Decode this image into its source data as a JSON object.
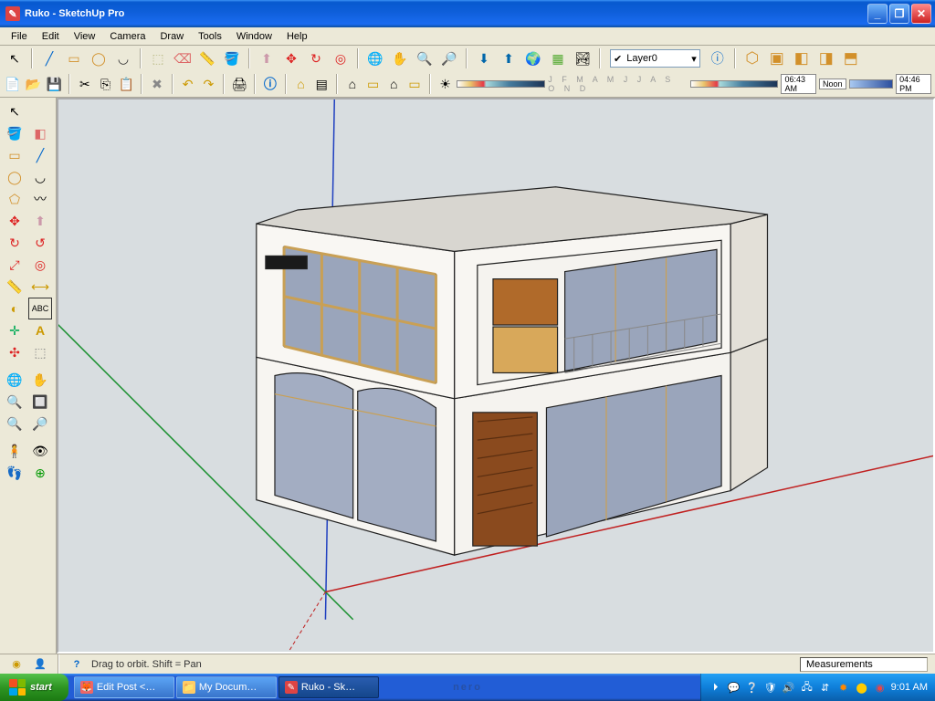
{
  "title": "Ruko - SketchUp Pro",
  "menu": [
    "File",
    "Edit",
    "View",
    "Camera",
    "Draw",
    "Tools",
    "Window",
    "Help"
  ],
  "layer": "Layer0",
  "months": "J F M A M J J A S O N D",
  "time1": "06:43 AM",
  "time_noon": "Noon",
  "time2": "04:46 PM",
  "status_msg": "Drag to orbit.  Shift = Pan",
  "measurements_label": "Measurements",
  "start": "start",
  "task1": "Edit Post <…",
  "task2": "My Docum…",
  "task3": "Ruko - Sk…",
  "clock": "9:01 AM",
  "nero": "nero"
}
